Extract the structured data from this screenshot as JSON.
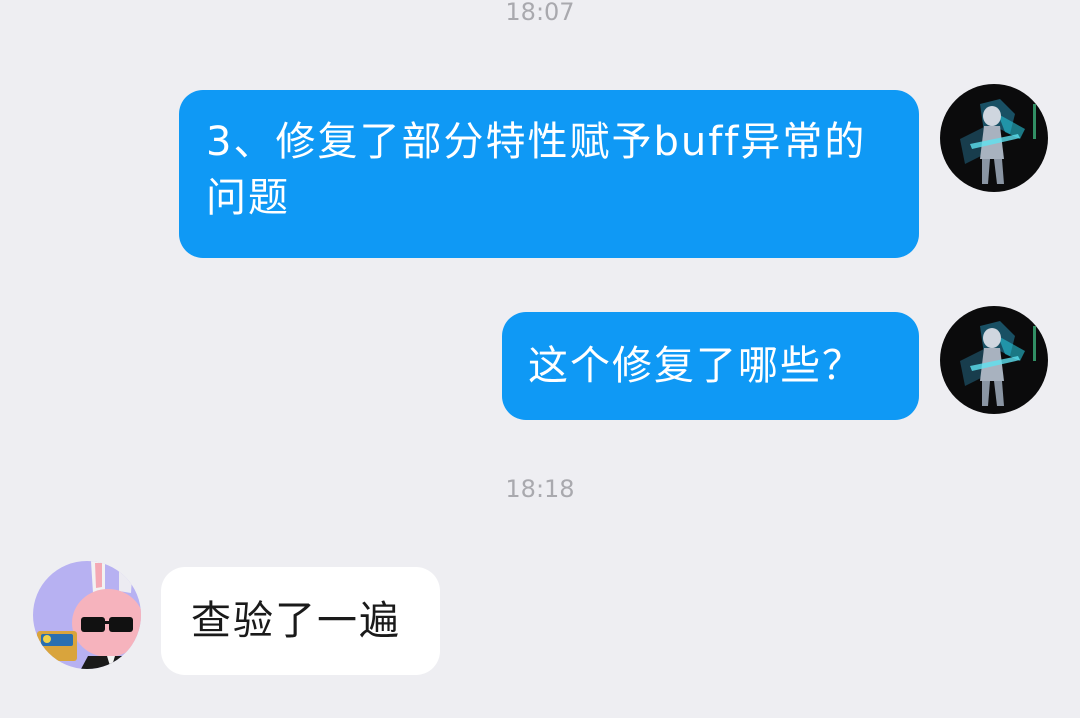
{
  "conversation": {
    "timestamps": [
      "18:07",
      "18:18"
    ],
    "messages": [
      {
        "sender": "self",
        "text": "3、修复了部分特性赋予buff异常的问题",
        "avatar_icon": "anime-character-avatar-icon"
      },
      {
        "sender": "self",
        "text": "这个修复了哪些？",
        "avatar_icon": "anime-character-avatar-icon"
      },
      {
        "sender": "other",
        "text": "查验了一遍",
        "avatar_icon": "bunny-sunglasses-avatar-icon"
      }
    ]
  },
  "colors": {
    "background": "#eeeef2",
    "outgoing_bubble": "#0f99f5",
    "incoming_bubble": "#ffffff",
    "timestamp_text": "#a9a9ae"
  }
}
